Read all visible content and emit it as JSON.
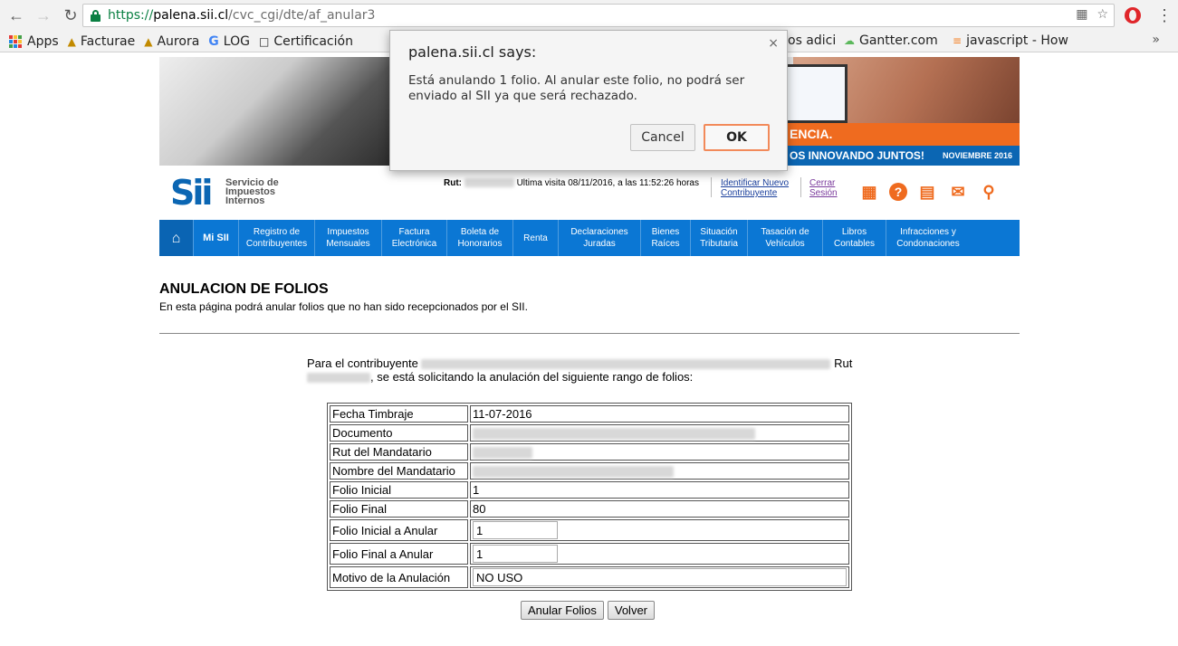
{
  "browser": {
    "url_scheme": "https://",
    "url_host": "palena.sii.cl",
    "url_path": "/cvc_cgi/dte/af_anular3",
    "bookmarks": [
      {
        "label": "Apps",
        "icon": "apps-grid-icon"
      },
      {
        "label": "Facturae",
        "icon": "pma-icon"
      },
      {
        "label": "Aurora",
        "icon": "pma-icon"
      },
      {
        "label": "LOG",
        "icon": "google-icon"
      },
      {
        "label": "Certificación",
        "icon": "page-icon"
      },
      {
        "label": "os adici",
        "icon": ""
      },
      {
        "label": "Gantter.com",
        "icon": "cloud-icon"
      },
      {
        "label": "javascript - How",
        "icon": "stackoverflow-icon"
      }
    ],
    "more_label": "»"
  },
  "banner": {
    "orange_text": "ENCIA.",
    "blue_text": "OS INNOVANDO JUNTOS!",
    "date_text": "NOVIEMBRE 2016"
  },
  "logo": {
    "mark": "Sii",
    "line1": "Servicio de",
    "line2": "Impuestos",
    "line3": "Internos"
  },
  "userbar": {
    "rut_label": "Rut:",
    "last_visit": "Ultima visita 08/11/2016, a las 11:52:26 horas",
    "identify_line1": "Identificar Nuevo",
    "identify_line2": "Contribuyente",
    "logout_line1": "Cerrar",
    "logout_line2": "Sesión"
  },
  "nav": {
    "home_icon": "house-icon",
    "items": [
      {
        "l1": "Mi SII",
        "l2": ""
      },
      {
        "l1": "Registro de",
        "l2": "Contribuyentes"
      },
      {
        "l1": "Impuestos",
        "l2": "Mensuales"
      },
      {
        "l1": "Factura",
        "l2": "Electrónica"
      },
      {
        "l1": "Boleta de",
        "l2": "Honorarios"
      },
      {
        "l1": "Renta",
        "l2": ""
      },
      {
        "l1": "Declaraciones",
        "l2": "Juradas"
      },
      {
        "l1": "Bienes",
        "l2": "Raíces"
      },
      {
        "l1": "Situación",
        "l2": "Tributaria"
      },
      {
        "l1": "Tasación de",
        "l2": "Vehículos"
      },
      {
        "l1": "Libros",
        "l2": "Contables"
      },
      {
        "l1": "Infracciones y",
        "l2": "Condonaciones"
      }
    ]
  },
  "page": {
    "title": "ANULACION DE FOLIOS",
    "subtitle": "En esta página podrá anular folios que no han sido recepcionados por el SII.",
    "para_start": "Para el contribuyente",
    "para_rut": "Rut",
    "para_end": ", se está solicitando la anulación del siguiente rango de folios:"
  },
  "form": {
    "fecha_label": "Fecha Timbraje",
    "fecha_value": "11-07-2016",
    "documento_label": "Documento",
    "rut_mandatario_label": "Rut del Mandatario",
    "nombre_mandatario_label": "Nombre del Mandatario",
    "folio_inicial_label": "Folio Inicial",
    "folio_inicial_value": "1",
    "folio_final_label": "Folio Final",
    "folio_final_value": "80",
    "anular_inicial_label": "Folio Inicial a Anular",
    "anular_inicial_value": "1",
    "anular_final_label": "Folio Final a Anular",
    "anular_final_value": "1",
    "motivo_label": "Motivo de la Anulación",
    "motivo_value": "NO USO"
  },
  "buttons": {
    "anular": "Anular Folios",
    "volver": "Volver"
  },
  "dialog": {
    "title": "palena.sii.cl says:",
    "message": "Está anulando 1 folio. Al anular este folio, no podrá ser enviado al SII ya que será rechazado.",
    "cancel": "Cancel",
    "ok": "OK",
    "close": "×"
  }
}
